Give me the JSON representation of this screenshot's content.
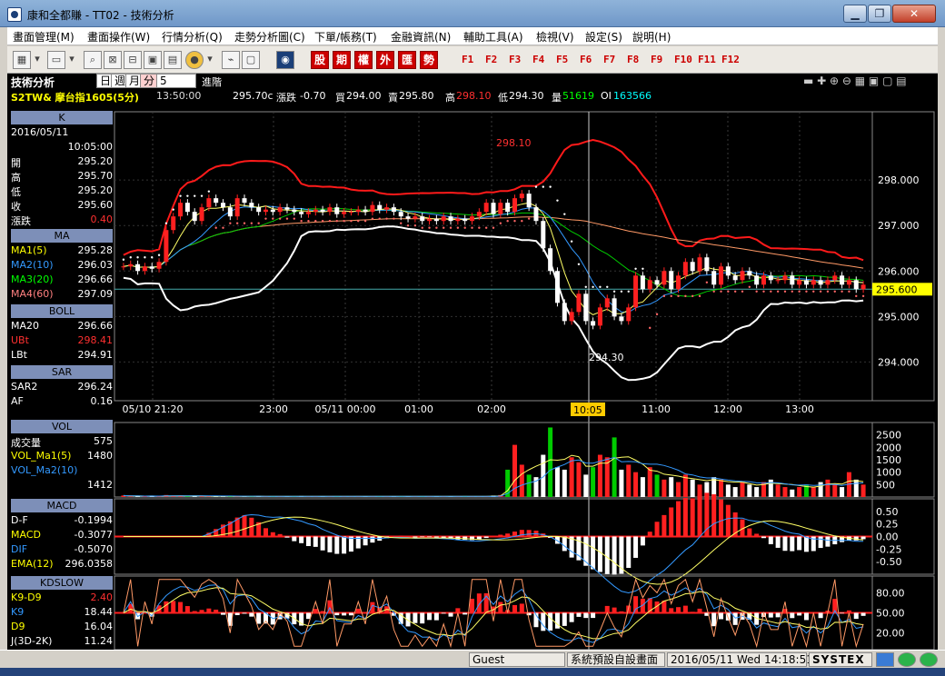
{
  "window": {
    "title": "康和全都賺 - TT02 - 技術分析"
  },
  "menu": [
    "畫面管理(M)",
    "畫面操作(W)",
    "行情分析(Q)",
    "走勢分析圖(C)",
    "下單/帳務(T)",
    "金融資訊(N)",
    "輔助工具(A)",
    "檢視(V)",
    "設定(S)",
    "說明(H)"
  ],
  "toolbar": {
    "red_buttons": [
      "股",
      "期",
      "權",
      "外",
      "匯",
      "勢"
    ],
    "fkeys": [
      "F1",
      "F2",
      "F3",
      "F4",
      "F5",
      "F6",
      "F7",
      "F8",
      "F9",
      "F10",
      "F11",
      "F12"
    ]
  },
  "header": {
    "panel_title": "技術分析",
    "periods": [
      "日",
      "週",
      "月",
      "分"
    ],
    "interval": "5",
    "advanced": "進階",
    "symbol": "S2TW& 摩台指1605(5分)",
    "time": "13:50:00",
    "price": "295.70c",
    "change_label": "漲跌",
    "change": "-0.70",
    "bid_label": "買",
    "bid": "294.00",
    "ask_label": "賣",
    "ask": "295.80",
    "high_label": "高",
    "high": "298.10",
    "low_label": "低",
    "low": "294.30",
    "vol_label": "量",
    "vol": "51619",
    "oi_label": "OI",
    "oi": "163566"
  },
  "left": {
    "k": {
      "title": "K",
      "date": "2016/05/11",
      "time": "10:05:00",
      "rows": [
        {
          "label": "開",
          "value": "295.20"
        },
        {
          "label": "高",
          "value": "295.70"
        },
        {
          "label": "低",
          "value": "295.20"
        },
        {
          "label": "收",
          "value": "295.60"
        },
        {
          "label": "漲跌",
          "value": "0.40"
        }
      ]
    },
    "ma": {
      "title": "MA",
      "rows": [
        {
          "label": "MA1(5)",
          "value": "295.28"
        },
        {
          "label": "MA2(10)",
          "value": "296.03"
        },
        {
          "label": "MA3(20)",
          "value": "296.66"
        },
        {
          "label": "MA4(60)",
          "value": "297.09"
        }
      ]
    },
    "boll": {
      "title": "BOLL",
      "rows": [
        {
          "label": "MA20",
          "value": "296.66"
        },
        {
          "label": "UBt",
          "value": "298.41"
        },
        {
          "label": "LBt",
          "value": "294.91"
        }
      ]
    },
    "sar": {
      "title": "SAR",
      "rows": [
        {
          "label": "SAR2",
          "value": "296.24"
        },
        {
          "label": "AF",
          "value": "0.16"
        }
      ]
    },
    "vol": {
      "title": "VOL",
      "rows": [
        {
          "label": "成交量",
          "value": "575"
        },
        {
          "label": "VOL_Ma1(5)",
          "value": "1480"
        },
        {
          "label": "VOL_Ma2(10)",
          "value": ""
        },
        {
          "label": "",
          "value": "1412"
        }
      ]
    },
    "macd": {
      "title": "MACD",
      "rows": [
        {
          "label": "D-F",
          "value": "-0.1994"
        },
        {
          "label": "MACD",
          "value": "-0.3077"
        },
        {
          "label": "DIF",
          "value": "-0.5070"
        },
        {
          "label": "EMA(12)",
          "value": "296.0358"
        }
      ]
    },
    "kd": {
      "title": "KDSLOW",
      "rows": [
        {
          "label": "K9-D9",
          "value": "2.40"
        },
        {
          "label": "K9",
          "value": "18.44"
        },
        {
          "label": "D9",
          "value": "16.04"
        },
        {
          "label": "J(3D-2K)",
          "value": "11.24"
        }
      ]
    }
  },
  "chart_data": {
    "type": "candlestick",
    "price_axis": {
      "ticks": [
        "298.000",
        "297.000",
        "296.000",
        "295.000",
        "294.000"
      ],
      "range": [
        293.15,
        299.5
      ],
      "current": "295.600"
    },
    "time_axis": [
      "05/10 21:20",
      "23:00",
      "05/11 00:00",
      "01:00",
      "02:00",
      "10:05",
      "11:00",
      "12:00",
      "13:00"
    ],
    "annotations": {
      "high": "298.10",
      "low": "294.30"
    },
    "close": [
      296.1,
      296.15,
      296.0,
      296.1,
      296.05,
      296.2,
      296.9,
      297.2,
      297.5,
      297.3,
      297.1,
      297.4,
      297.6,
      297.5,
      297.4,
      297.2,
      297.6,
      297.5,
      297.4,
      297.3,
      297.35,
      297.3,
      297.4,
      297.35,
      297.3,
      297.25,
      297.3,
      297.35,
      297.3,
      297.4,
      297.25,
      297.3,
      297.3,
      297.35,
      297.3,
      297.45,
      297.35,
      297.4,
      297.3,
      297.2,
      297.15,
      297.2,
      297.1,
      297.15,
      297.1,
      297.2,
      297.1,
      297.15,
      297.1,
      297.2,
      297.3,
      297.5,
      297.25,
      297.5,
      297.3,
      297.6,
      297.7,
      297.4,
      297.1,
      296.5,
      296.0,
      295.3,
      294.9,
      295.1,
      295.5,
      294.9,
      294.8,
      295.2,
      295.4,
      295.0,
      294.9,
      295.2,
      295.9,
      295.6,
      295.8,
      295.7,
      296.0,
      295.6,
      295.9,
      296.2,
      296.0,
      296.3,
      296.0,
      295.7,
      296.1,
      295.9,
      295.8,
      296.0,
      295.9,
      295.7,
      295.9,
      295.8,
      295.8,
      295.9,
      295.7,
      295.8,
      295.7,
      295.8,
      295.7,
      295.8,
      295.9,
      295.7,
      295.8,
      295.6,
      295.7
    ],
    "volume": [
      60,
      30,
      40,
      20,
      50,
      30,
      80,
      60,
      40,
      30,
      50,
      40,
      30,
      20,
      30,
      40,
      30,
      20,
      30,
      40,
      30,
      20,
      30,
      20,
      30,
      40,
      30,
      20,
      30,
      20,
      30,
      20,
      30,
      40,
      20,
      30,
      20,
      30,
      20,
      30,
      20,
      30,
      20,
      30,
      20,
      30,
      20,
      30,
      40,
      30,
      20,
      30,
      60,
      80,
      1100,
      2100,
      1300,
      900,
      800,
      1700,
      2800,
      1200,
      1100,
      1600,
      1400,
      900,
      1200,
      1700,
      1600,
      2400,
      1100,
      1300,
      1000,
      800,
      1200,
      900,
      700,
      800,
      600,
      900,
      700,
      500,
      600,
      800,
      700,
      500,
      400,
      600,
      500,
      400,
      600,
      700,
      500,
      400,
      300,
      400,
      500,
      400,
      600,
      700,
      500,
      400,
      1000,
      700,
      500
    ],
    "vol_axis": [
      "2500",
      "2000",
      "1500",
      "1000",
      "500"
    ],
    "macd_axis": [
      "0.50",
      "0.25",
      "0.00",
      "-0.25",
      "-0.50"
    ],
    "kd_axis": [
      "80.00",
      "50.00",
      "20.00"
    ]
  },
  "status": {
    "user": "Guest",
    "layout": "系統預設自設畫面",
    "datetime": "2016/05/11 Wed 14:18:51",
    "brand": "SYSTEX"
  }
}
